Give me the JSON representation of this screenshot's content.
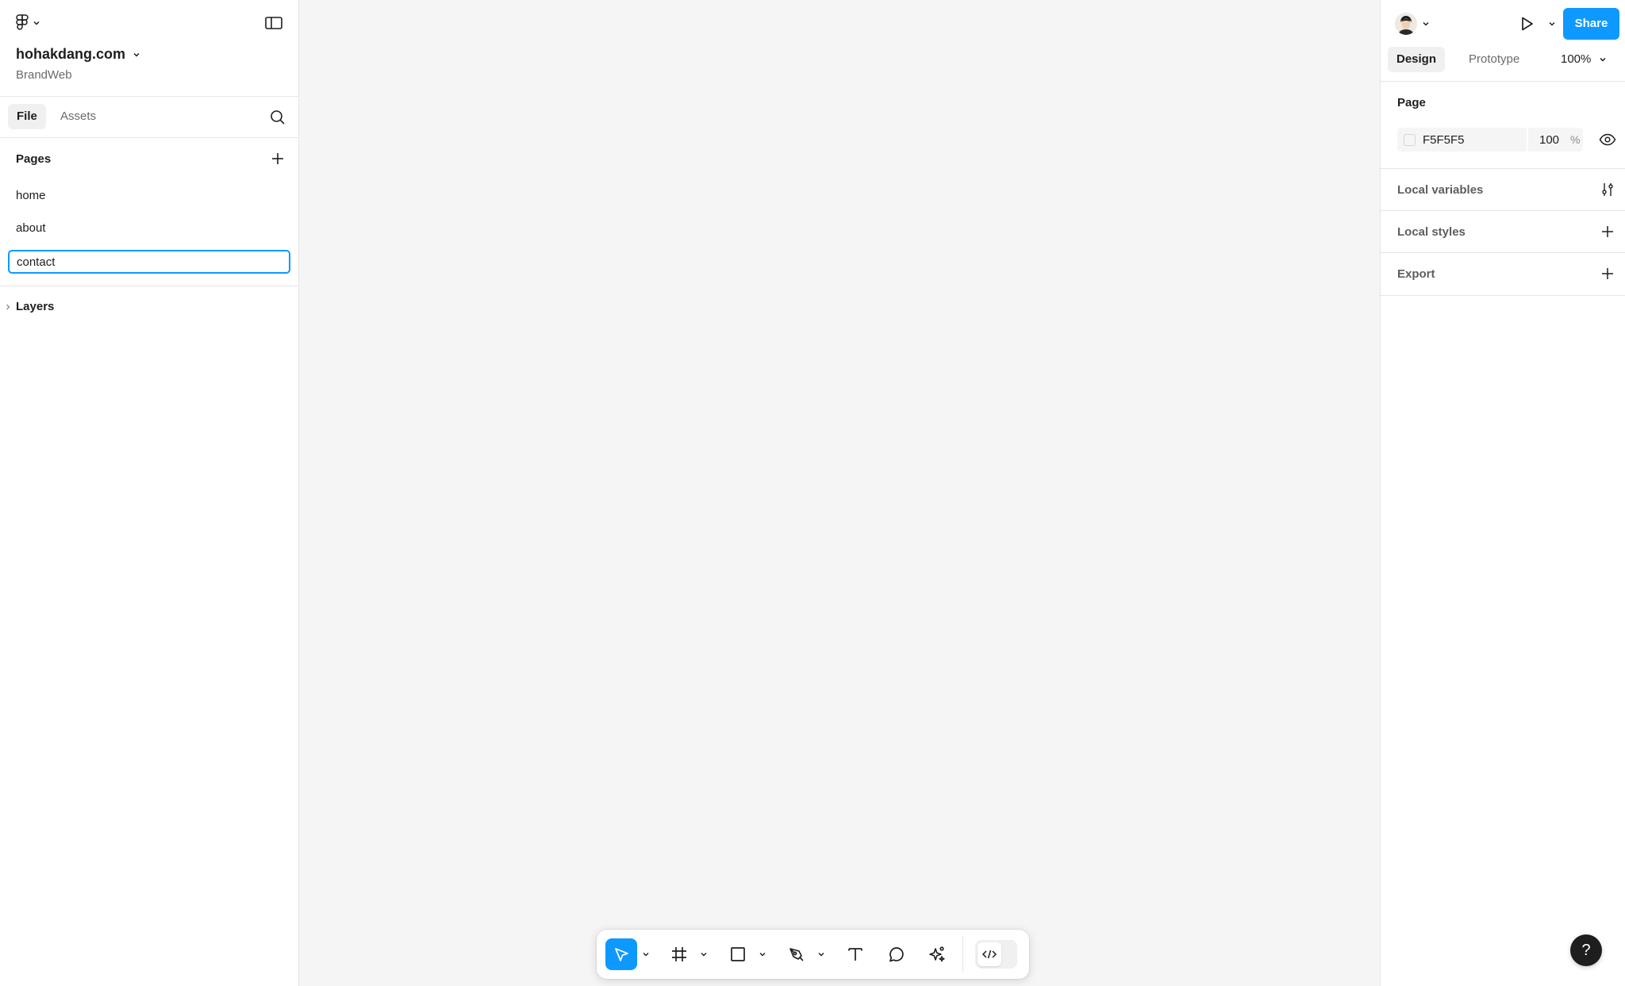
{
  "header": {
    "file_name": "hohakdang.com",
    "project_name": "BrandWeb"
  },
  "left_tabs": {
    "file": "File",
    "assets": "Assets"
  },
  "pages": {
    "title": "Pages",
    "items": [
      "home",
      "about"
    ],
    "editing_value": "contact"
  },
  "layers": {
    "title": "Layers"
  },
  "right_header": {
    "share_label": "Share"
  },
  "right_tabs": {
    "design": "Design",
    "prototype": "Prototype",
    "zoom": "100%"
  },
  "page_section": {
    "title": "Page",
    "color_hex": "F5F5F5",
    "opacity": "100",
    "opacity_unit": "%"
  },
  "sections": {
    "local_variables": "Local variables",
    "local_styles": "Local styles",
    "export": "Export"
  },
  "help": {
    "label": "?"
  },
  "colors": {
    "accent": "#0d99ff",
    "canvas": "#F5F5F5"
  },
  "icons": {
    "main_menu": "figma-logo-icon",
    "panel_toggle": "sidebar-toggle-icon",
    "search": "search-icon",
    "add": "plus-icon",
    "present": "play-icon",
    "visibility": "eye-icon",
    "variables": "sliders-icon",
    "toolbar": [
      "move-icon",
      "frame-icon",
      "rectangle-icon",
      "pen-icon",
      "text-icon",
      "comment-icon",
      "ai-sparkle-icon",
      "code-icon"
    ]
  }
}
